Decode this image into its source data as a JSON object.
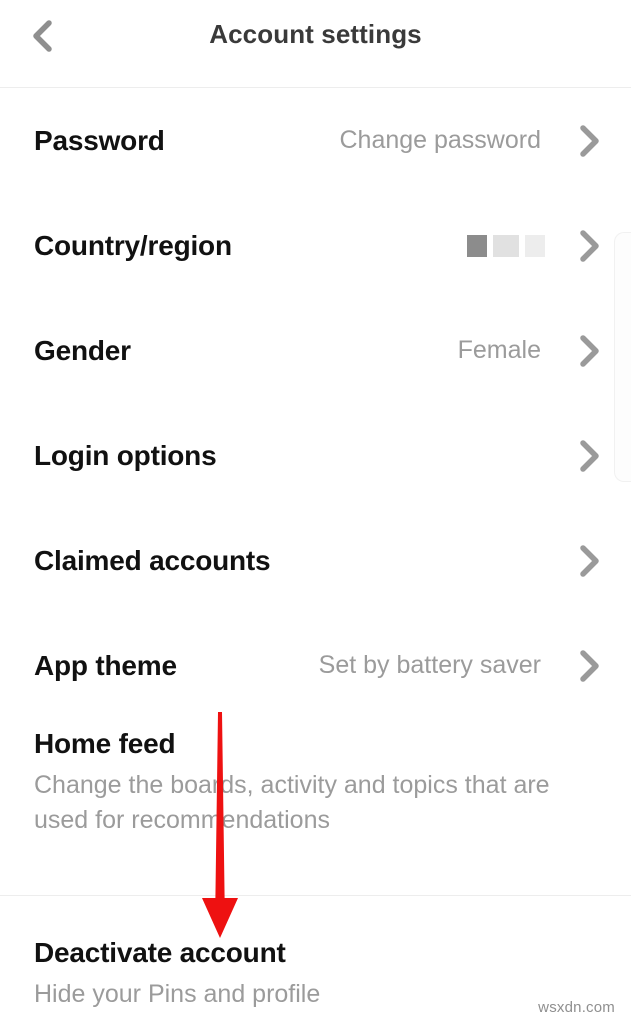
{
  "header": {
    "title": "Account settings",
    "back_icon": "chevron-left-icon"
  },
  "settings_rows": [
    {
      "label": "Password",
      "value": "Change password",
      "redacted": false,
      "chevron": "chevron-right-icon"
    },
    {
      "label": "Country/region",
      "value": "",
      "redacted": true,
      "chevron": "chevron-right-icon"
    },
    {
      "label": "Gender",
      "value": "Female",
      "redacted": false,
      "chevron": "chevron-right-icon"
    },
    {
      "label": "Login options",
      "value": "",
      "redacted": false,
      "chevron": "chevron-right-icon"
    },
    {
      "label": "Claimed accounts",
      "value": "",
      "redacted": false,
      "chevron": "chevron-right-icon"
    },
    {
      "label": "App theme",
      "value": "Set by battery saver",
      "redacted": false,
      "chevron": "chevron-right-icon"
    }
  ],
  "home_feed": {
    "title": "Home feed",
    "subtitle": "Change the boards, activity and topics that are used for recommendations"
  },
  "deactivate": {
    "title": "Deactivate account",
    "subtitle": "Hide your Pins and profile"
  },
  "annotation": {
    "arrow_icon": "red-down-arrow-icon",
    "color": "#ee1111"
  },
  "watermark": {
    "text": "wsxdn.com"
  },
  "colors": {
    "background": "#ffffff",
    "label_text": "#111111",
    "value_text": "#9b9b9b",
    "chevron": "#9a9a9a",
    "divider": "#ededed",
    "annotation_red": "#ee1111"
  }
}
